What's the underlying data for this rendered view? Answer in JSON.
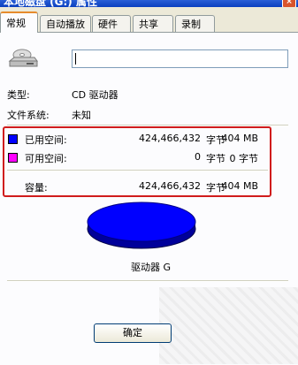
{
  "window": {
    "title": "本地磁盘 (G:) 属性",
    "close_label": "×"
  },
  "tabs": [
    {
      "label": "常规"
    },
    {
      "label": "自动播放"
    },
    {
      "label": "硬件"
    },
    {
      "label": "共享"
    },
    {
      "label": "录制"
    }
  ],
  "general": {
    "name_value": "",
    "type_label": "类型:",
    "type_value": "CD 驱动器",
    "fs_label": "文件系统:",
    "fs_value": "未知",
    "used": {
      "label": "已用空间:",
      "bytes": "424,466,432",
      "unit": "字节",
      "size": "404 MB",
      "color": "#0000ff"
    },
    "free": {
      "label": "可用空间:",
      "bytes": "0",
      "unit": "字节",
      "size": "0 字节",
      "color": "#ff00ff"
    },
    "capacity": {
      "label": "容量:",
      "bytes": "424,466,432",
      "unit": "字节",
      "size": "404 MB"
    },
    "drive_label": "驱动器 G",
    "ok_label": "确定"
  }
}
